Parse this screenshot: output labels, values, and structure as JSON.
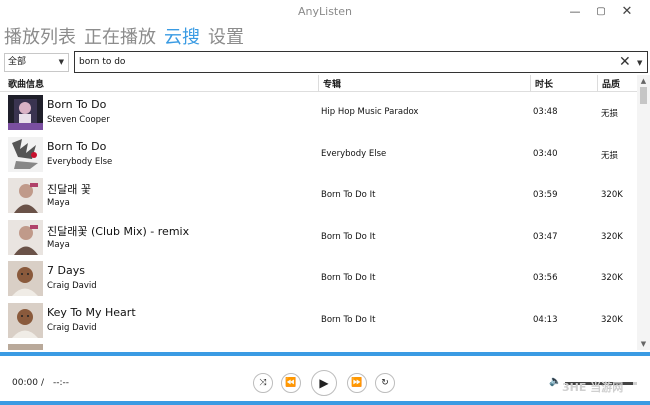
{
  "window": {
    "title": "AnyListen",
    "min_glyph": "—",
    "max_glyph": "▢",
    "close_glyph": "✕"
  },
  "tabs": [
    {
      "label": "播放列表",
      "active": false
    },
    {
      "label": "正在播放",
      "active": false
    },
    {
      "label": "云搜",
      "active": true
    },
    {
      "label": "设置",
      "active": false
    }
  ],
  "search": {
    "scope_selected": "全部",
    "query": "born to do",
    "clear_glyph": "✕",
    "dropdown_glyph": "▼"
  },
  "table": {
    "headers": {
      "info": "歌曲信息",
      "album": "专辑",
      "duration": "时长",
      "quality": "品质"
    },
    "rows": [
      {
        "title": "Born To Do",
        "artist": "Steven Cooper",
        "album": "Hip Hop Music Paradox",
        "duration": "03:48",
        "quality": "无损",
        "cover": "dark-portrait-cover"
      },
      {
        "title": "Born To Do",
        "artist": "Everybody Else",
        "album": "Everybody Else",
        "duration": "03:40",
        "quality": "无损",
        "cover": "sketch-art-cover"
      },
      {
        "title": "진달래 꽃",
        "artist": "Maya",
        "album": "Born To Do It",
        "duration": "03:59",
        "quality": "320K",
        "cover": "portrait-cover"
      },
      {
        "title": "진달래꽃 (Club Mix) - remix",
        "artist": "Maya",
        "album": "Born To Do It",
        "duration": "03:47",
        "quality": "320K",
        "cover": "portrait-cover"
      },
      {
        "title": "7 Days",
        "artist": "Craig David",
        "album": "Born To Do It",
        "duration": "03:56",
        "quality": "320K",
        "cover": "portrait-cover"
      },
      {
        "title": "Key To My Heart",
        "artist": "Craig David",
        "album": "Born To Do It",
        "duration": "04:13",
        "quality": "320K",
        "cover": "portrait-cover"
      }
    ]
  },
  "player": {
    "current_time": "00:00",
    "separator": "/",
    "total_time": "--:--",
    "controls": {
      "shuffle": "⤨",
      "previous": "⏪",
      "play": "▶",
      "next": "⏩",
      "repeat": "↻"
    },
    "volume_glyph": "🔈",
    "volume_level": 0.95
  },
  "watermark": "3HE 当游网",
  "colors": {
    "accent": "#3a9be3",
    "inactive_tab": "#8c8c8c"
  }
}
